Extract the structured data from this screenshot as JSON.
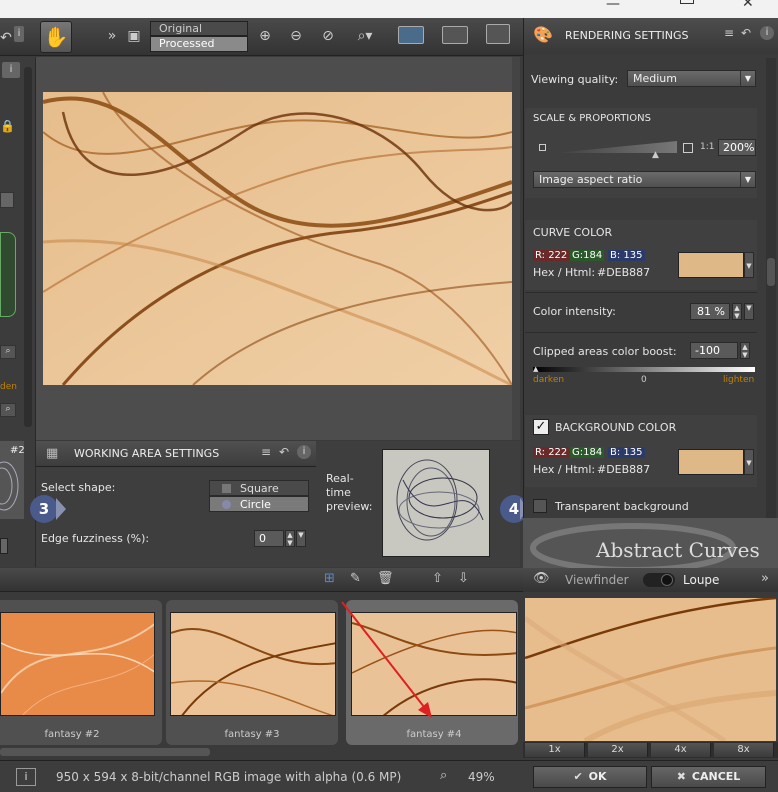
{
  "toolbar": {
    "view_original": "Original",
    "view_processed": "Processed",
    "more_label": "»"
  },
  "rendering": {
    "title": "RENDERING SETTINGS",
    "viewing_quality_label": "Viewing quality:",
    "viewing_quality_value": "Medium",
    "scale_title": "SCALE & PROPORTIONS",
    "scale_ratio_label": "1:1",
    "scale_value": "200%",
    "aspect_value": "Image aspect ratio",
    "curve_color_title": "CURVE COLOR",
    "curve_r": "R: 222",
    "curve_g": "G:184",
    "curve_b": "B: 135",
    "curve_hex_label": "Hex / Html:",
    "curve_hex_value": "#DEB887",
    "intensity_label": "Color intensity:",
    "intensity_value": "81 %",
    "clip_label": "Clipped areas color boost:",
    "clip_value": "-100",
    "clip_min": "darken",
    "clip_mid": "0",
    "clip_max": "lighten",
    "bg_title": "BACKGROUND COLOR",
    "bg_r": "R: 222",
    "bg_g": "G:184",
    "bg_b": "B: 135",
    "bg_hex_label": "Hex / Html:",
    "bg_hex_value": "#DEB887",
    "transparent_label": "Transparent background",
    "badge4": "4"
  },
  "working_area": {
    "title": "WORKING AREA SETTINGS",
    "shape_label": "Select shape:",
    "shape_square": "Square",
    "shape_circle": "Circle",
    "fuzziness_label": "Edge fuzziness (%):",
    "fuzziness_value": "0",
    "preview_label": "Real-time preview:",
    "badge3": "3",
    "left_number": "#2"
  },
  "logo": {
    "text": "Abstract Curves"
  },
  "viewfinder": {
    "viewfinder_label": "Viewfinder",
    "loupe_label": "Loupe",
    "more": "»",
    "zooms": [
      "1x",
      "2x",
      "4x",
      "8x"
    ]
  },
  "film": {
    "thumbs": [
      {
        "label": "fantasy #2"
      },
      {
        "label": "fantasy #3"
      },
      {
        "label": "fantasy #4"
      }
    ]
  },
  "status": {
    "info": "950 x 594 x 8-bit/channel RGB image with alpha  (0.6 MP)",
    "zoom": "49%",
    "left_hint": "den"
  },
  "buttons": {
    "ok": "OK",
    "cancel": "CANCEL"
  },
  "colors": {
    "curve": "#DEB887",
    "accent": "#c08000",
    "arrow": "#e02020"
  }
}
